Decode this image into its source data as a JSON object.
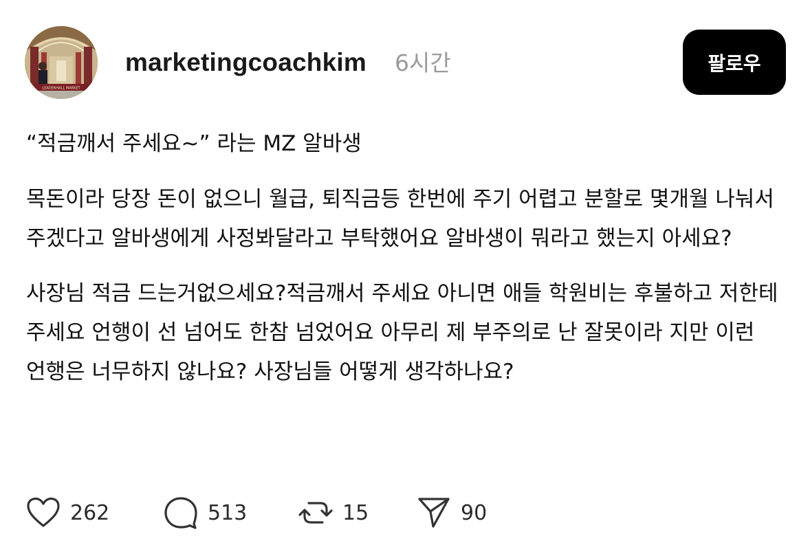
{
  "post": {
    "author": {
      "username": "marketingcoachkim",
      "time_ago": "6시간",
      "avatar_icon": "profile-photo-market-arcade",
      "avatar_sign_text": "LEADENHALL MARKET"
    },
    "follow_label": "팔로우",
    "title": "“적금깨서 주세요~” 라는 MZ 알바생",
    "paragraphs": [
      "목돈이라 당장 돈이 없으니 월급, 퇴직금등 한번에 주기 어렵고 분할로 몇개월 나눠서 주겠다고 알바생에게 사정봐달라고 부탁했어요 알바생이 뭐라고 했는지 아세요?",
      "사장님 적금 드는거없으세요?적금깨서 주세요 아니면 애들 학원비는 후불하고 저한테 주세요 언행이 선 넘어도 한참 넘었어요 아무리 제 부주의로 난 잘못이라 지만 이런 언행은 너무하지 않나요? 사장님들 어떻게 생각하나요?"
    ],
    "actions": {
      "likes": "262",
      "replies": "513",
      "reposts": "15",
      "shares": "90"
    },
    "icons": {
      "like": "heart-icon",
      "reply": "comment-bubble-icon",
      "repost": "repost-icon",
      "share": "send-icon"
    },
    "colors": {
      "follow_button_bg": "#000000",
      "follow_button_text": "#ffffff",
      "timestamp": "#9a9a9a"
    }
  }
}
